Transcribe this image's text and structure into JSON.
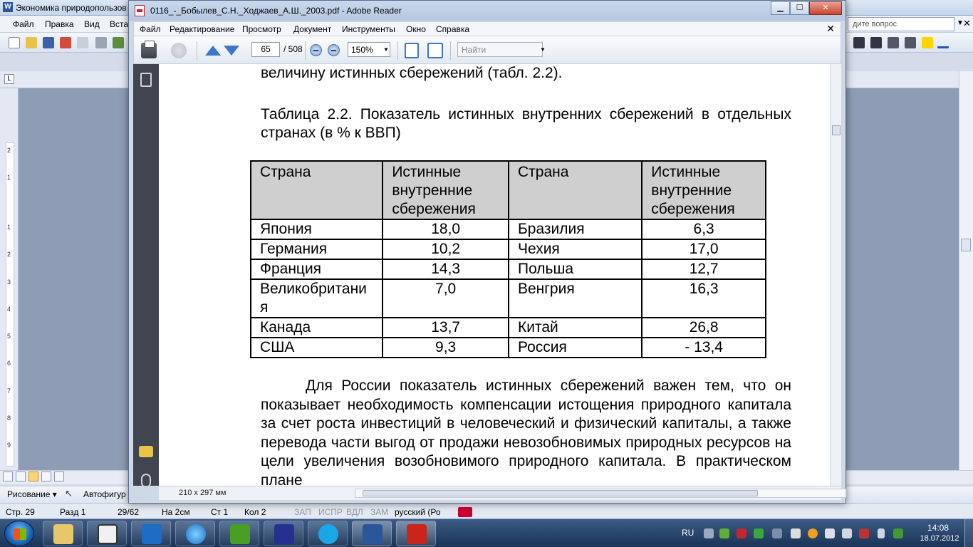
{
  "word": {
    "title": "Экономика природопользов",
    "menu": [
      "Файл",
      "Правка",
      "Вид",
      "Вста"
    ],
    "help_placeholder": "дите вопрос",
    "drawbar": {
      "draw_label": "Рисование ▾",
      "autoshapes_label": "Автофигур"
    },
    "status": {
      "page": "Стр. 29",
      "section": "Разд 1",
      "pages": "29/62",
      "at": "На 2см",
      "line": "Ст 1",
      "col": "Кол 2",
      "rec": "ЗАП",
      "trk": "ИСПР",
      "ext": "ВДЛ",
      "ovr": "ЗАМ",
      "lang": "русский (Ро"
    },
    "ruler_numbers": [
      "2",
      "1",
      "1",
      "2",
      "3",
      "4",
      "5",
      "6",
      "7",
      "8",
      "9"
    ]
  },
  "reader": {
    "title": "0116_-_Бобылев_С.Н._Ходжаев_А.Ш._2003.pdf - Adobe Reader",
    "menu": [
      "Файл",
      "Редактирование",
      "Просмотр",
      "Документ",
      "Инструменты",
      "Окно",
      "Справка"
    ],
    "page_current": "65",
    "page_total": "/ 508",
    "zoom": "150%",
    "find_placeholder": "Найти",
    "page_size": "210 x 297 мм"
  },
  "pdf": {
    "prev_line": "величину истинных сбережений (табл. 2.2).",
    "table_caption": "Таблица 2.2. Показатель истинных внутренних сбережений в отдельных странах (в % к ВВП)",
    "headers": [
      "Страна",
      "Истинные внутренние сбережения",
      "Страна",
      "Истинные внутренние сбережения"
    ],
    "rows": [
      [
        "Япония",
        "18,0",
        "Бразилия",
        "6,3"
      ],
      [
        "Германия",
        "10,2",
        "Чехия",
        "17,0"
      ],
      [
        "Франция",
        "14,3",
        "Польша",
        "12,7"
      ],
      [
        "Великобритания",
        "7,0",
        "Венгрия",
        "16,3"
      ],
      [
        "Канада",
        "13,7",
        "Китай",
        "26,8"
      ],
      [
        "США",
        "9,3",
        "Россия",
        "- 13,4"
      ]
    ],
    "paragraph": "Для России показатель истинных сбережений важен тем, что он показывает необходимость компенсации истощения природного капитала за счет роста инвестиций в человеческий и физический капиталы, а также перевода части выгод от продажи невозобновимых природных ресурсов на цели увеличения возобновимого природного капитала. В практическом плане"
  },
  "taskbar": {
    "lang": "RU",
    "time": "14:08",
    "date": "18.07.2012"
  }
}
